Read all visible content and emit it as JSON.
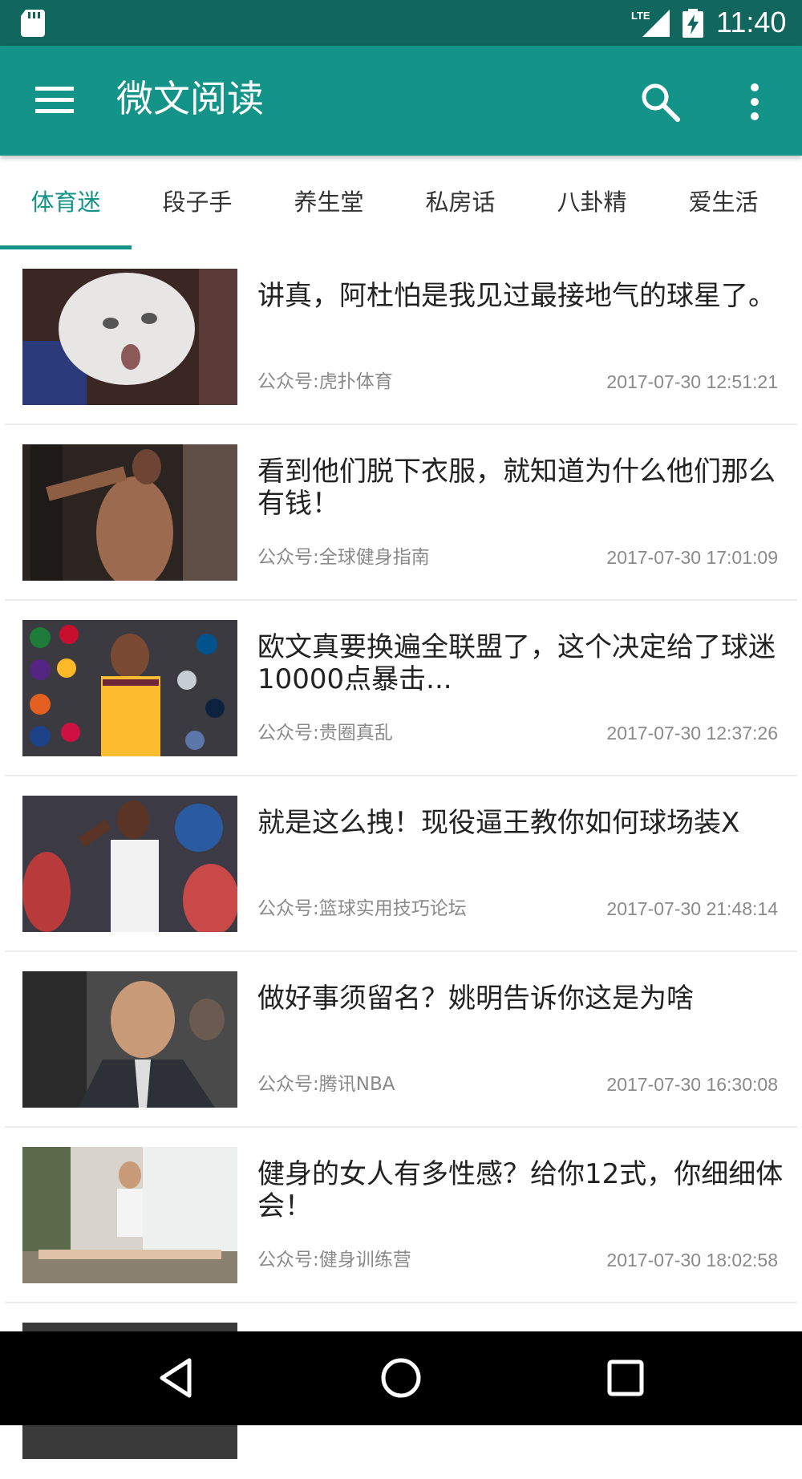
{
  "status_bar": {
    "time": "11:40",
    "network": "LTE"
  },
  "app_bar": {
    "title": "微文阅读"
  },
  "tabs": [
    {
      "label": "体育迷",
      "active": true
    },
    {
      "label": "段子手",
      "active": false
    },
    {
      "label": "养生堂",
      "active": false
    },
    {
      "label": "私房话",
      "active": false
    },
    {
      "label": "八卦精",
      "active": false
    },
    {
      "label": "爱生活",
      "active": false
    }
  ],
  "articles": [
    {
      "title": "讲真，阿杜怕是我见过最接地气的球星了。",
      "source": "公众号:虎扑体育",
      "time": "2017-07-30 12:51:21"
    },
    {
      "title": "看到他们脱下衣服，就知道为什么他们那么有钱！",
      "source": "公众号:全球健身指南",
      "time": "2017-07-30 17:01:09"
    },
    {
      "title": "欧文真要换遍全联盟了，这个决定给了球迷10000点暴击...",
      "source": "公众号:贵圈真乱",
      "time": "2017-07-30 12:37:26"
    },
    {
      "title": "就是这么拽！现役逼王教你如何球场装X",
      "source": "公众号:篮球实用技巧论坛",
      "time": "2017-07-30 21:48:14"
    },
    {
      "title": "做好事须留名？姚明告诉你这是为啥",
      "source": "公众号:腾讯NBA",
      "time": "2017-07-30 16:30:08"
    },
    {
      "title": "健身的女人有多性感？给你12式，你细细体会！",
      "source": "公众号:健身训练营",
      "time": "2017-07-30 18:02:58"
    }
  ],
  "colors": {
    "primary": "#149488",
    "primary_dark": "#11665d",
    "accent_tab": "#149488"
  }
}
